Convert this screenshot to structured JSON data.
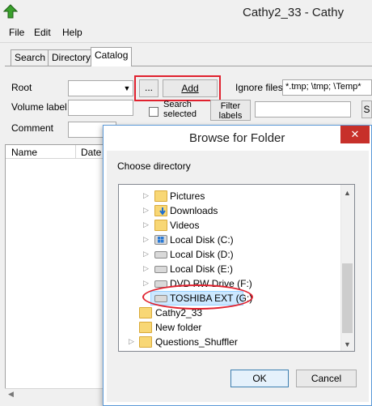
{
  "window": {
    "title": "Cathy2_33 - Cathy"
  },
  "menu": [
    "File",
    "Edit",
    "Help"
  ],
  "tabs": [
    "Search",
    "Directory",
    "Catalog"
  ],
  "form": {
    "root_label": "Root",
    "browse_label": "...",
    "add_label": "Add",
    "ignore_files_label": "Ignore files",
    "ignore_files_value": "*.tmp; \\tmp; \\Temp*",
    "volume_label": "Volume label",
    "search_selected_label": "Search selected",
    "filter_labels_label": "Filter labels",
    "comment_label": "Comment",
    "right_btn_label": "S"
  },
  "list": {
    "columns": [
      "Name",
      "Date"
    ]
  },
  "dialog": {
    "title": "Browse for Folder",
    "close": "✕",
    "prompt": "Choose directory",
    "tree": [
      {
        "label": "Pictures",
        "icon": "pictures-folder-icon"
      },
      {
        "label": "Downloads",
        "icon": "downloads-folder-icon"
      },
      {
        "label": "Videos",
        "icon": "videos-folder-icon"
      },
      {
        "label": "Local Disk (C:)",
        "icon": "system-drive-icon"
      },
      {
        "label": "Local Disk (D:)",
        "icon": "drive-icon"
      },
      {
        "label": "Local Disk (E:)",
        "icon": "drive-icon"
      },
      {
        "label": "DVD RW Drive (F:)",
        "icon": "dvd-drive-icon"
      },
      {
        "label": "TOSHIBA EXT (G:)",
        "icon": "external-drive-icon"
      },
      {
        "label": "Cathy2_33",
        "icon": "folder-icon"
      },
      {
        "label": "New folder",
        "icon": "folder-icon"
      },
      {
        "label": "Questions_Shuffler",
        "icon": "folder-icon"
      }
    ],
    "ok_label": "OK",
    "cancel_label": "Cancel"
  },
  "colors": {
    "highlight_red": "#e0212e",
    "selection": "#cce8ff",
    "close_red": "#c7302a"
  }
}
